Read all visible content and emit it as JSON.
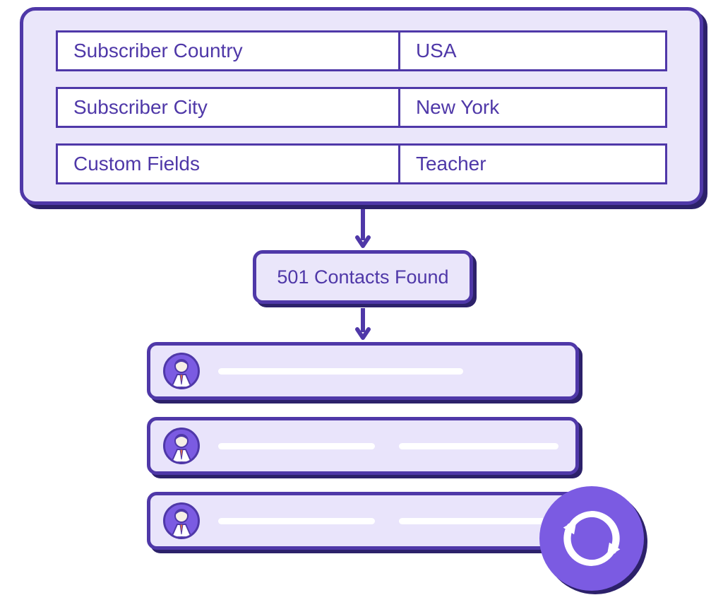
{
  "filters": {
    "rows": [
      {
        "label": "Subscriber Country",
        "value": "USA"
      },
      {
        "label": "Subscriber City",
        "value": "New York"
      },
      {
        "label": "Custom Fields",
        "value": "Teacher"
      }
    ]
  },
  "result": {
    "summary_label": "501 Contacts Found"
  },
  "contacts": {
    "rows_visible": 3
  },
  "icons": {
    "refresh": "refresh-icon",
    "avatar": "person-avatar-icon",
    "arrow": "flow-arrow-icon"
  },
  "colors": {
    "primary": "#4F38A8",
    "lavender": "#EAE6FA",
    "accent": "#7B5BE2",
    "shadow": "#2C216A"
  }
}
